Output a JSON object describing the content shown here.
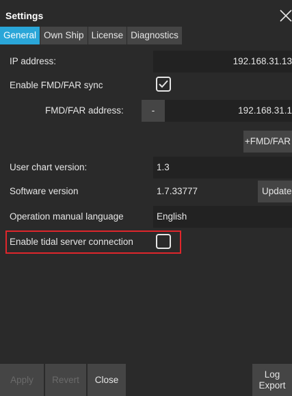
{
  "window": {
    "title": "Settings",
    "close_icon": "close-icon"
  },
  "tabs": [
    {
      "label": "General",
      "active": true
    },
    {
      "label": "Own Ship",
      "active": false
    },
    {
      "label": "License",
      "active": false
    },
    {
      "label": "Diagnostics",
      "active": false
    }
  ],
  "general": {
    "ip_address": {
      "label": "IP address:",
      "value": "192.168.31.13"
    },
    "fmd_sync": {
      "label": "Enable FMD/FAR sync",
      "checked": true
    },
    "fmd_address": {
      "label": "FMD/FAR address:",
      "remove_label": "-",
      "value": "192.168.31.1"
    },
    "add_fmd": {
      "label": "+FMD/FAR"
    },
    "chart_version": {
      "label": "User chart version:",
      "value": "1.3"
    },
    "software_version": {
      "label": "Software version",
      "value": "1.7.33777",
      "update_label": "Update"
    },
    "manual_language": {
      "label": "Operation manual language",
      "value": "English"
    },
    "tidal_server": {
      "label": "Enable tidal server connection",
      "checked": false
    }
  },
  "buttons": {
    "apply": "Apply",
    "revert": "Revert",
    "close": "Close",
    "log_export_line1": "Log",
    "log_export_line2": "Export"
  },
  "colors": {
    "background": "#2a2a2a",
    "field": "#222222",
    "button": "#454545",
    "accent_tab": "#2aa6d8",
    "highlight": "#e0262b",
    "disabled_text": "#6a6a6a"
  }
}
